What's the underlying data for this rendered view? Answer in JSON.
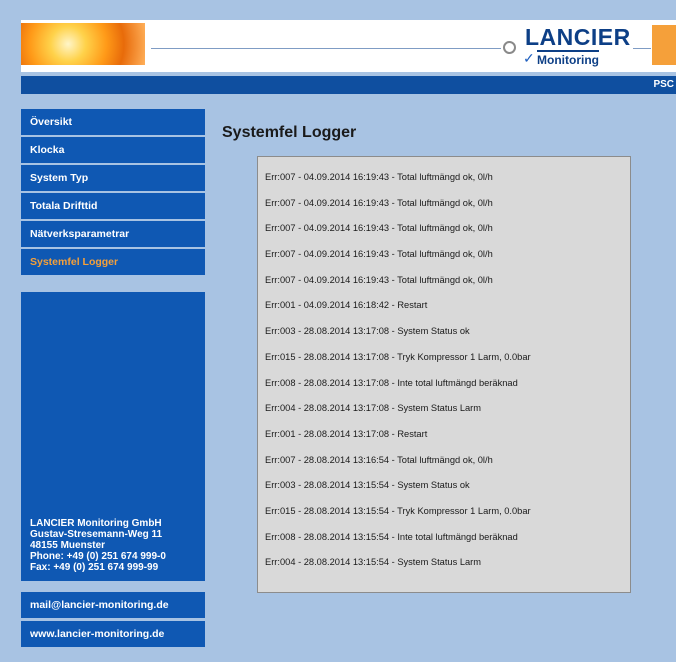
{
  "header": {
    "brand_top": "LANCIER",
    "brand_bottom": "Monitoring",
    "nav_right": "PSC"
  },
  "sidebar": {
    "items": [
      {
        "label": "Översikt"
      },
      {
        "label": "Klocka"
      },
      {
        "label": "System Typ"
      },
      {
        "label": "Totala Drifttid"
      },
      {
        "label": "Nätverksparametrar"
      },
      {
        "label": "Systemfel Logger",
        "active": true
      }
    ],
    "company": {
      "name": "LANCIER Monitoring GmbH",
      "street": "Gustav-Stresemann-Weg 11",
      "city": "48155 Muenster",
      "phone": "Phone: +49 (0) 251 674 999-0",
      "fax": "Fax: +49 (0) 251 674 999-99"
    },
    "email": "mail@lancier-monitoring.de",
    "website": "www.lancier-monitoring.de"
  },
  "main": {
    "title": "Systemfel Logger",
    "log_entries": [
      "Err:007 - 04.09.2014 16:19:43 - Total luftmängd ok, 0l/h",
      "Err:007 - 04.09.2014 16:19:43 - Total luftmängd ok, 0l/h",
      "Err:007 - 04.09.2014 16:19:43 - Total luftmängd ok, 0l/h",
      "Err:007 - 04.09.2014 16:19:43 - Total luftmängd ok, 0l/h",
      "Err:007 - 04.09.2014 16:19:43 - Total luftmängd ok, 0l/h",
      "Err:001 - 04.09.2014 16:18:42 - Restart",
      "Err:003 - 28.08.2014 13:17:08 - System Status ok",
      "Err:015 - 28.08.2014 13:17:08 - Tryk Kompressor 1 Larm, 0.0bar",
      "Err:008 - 28.08.2014 13:17:08 - Inte total luftmängd beräknad",
      "Err:004 - 28.08.2014 13:17:08 - System Status Larm",
      "Err:001 - 28.08.2014 13:17:08 - Restart",
      "Err:007 - 28.08.2014 13:16:54 - Total luftmängd ok, 0l/h",
      "Err:003 - 28.08.2014 13:15:54 - System Status ok",
      "Err:015 - 28.08.2014 13:15:54 - Tryk Kompressor 1 Larm, 0.0bar",
      "Err:008 - 28.08.2014 13:15:54 - Inte total luftmängd beräknad",
      "Err:004 - 28.08.2014 13:15:54 - System Status Larm"
    ]
  }
}
